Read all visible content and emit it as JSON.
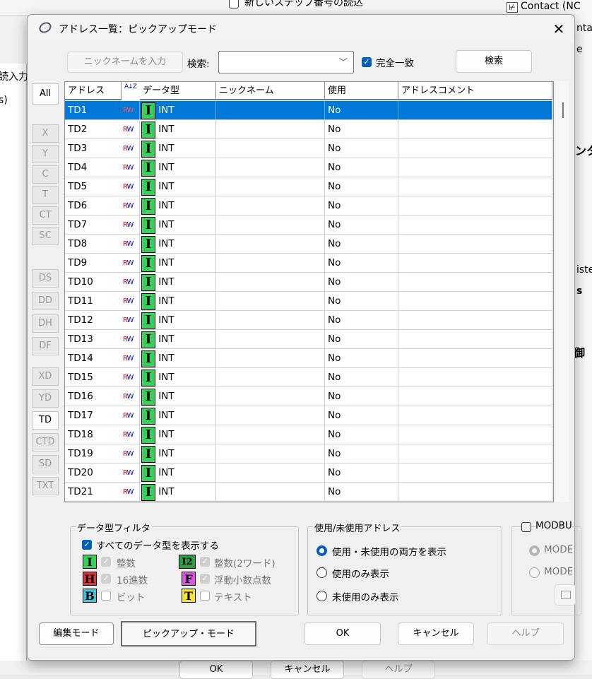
{
  "background": {
    "top_text": "新しいステップ番号の読込",
    "top_right": "Contact (NC",
    "right_fragments": [
      "nta",
      "e",
      "ンタ",
      "iste",
      "s",
      "御"
    ],
    "left_fragments": [
      "読入力",
      "s)"
    ],
    "bottom_buttons": [
      "OK",
      "キャンセル",
      "ヘルプ"
    ]
  },
  "dialog": {
    "title": "アドレス一覧：ピックアップモード",
    "close": "✕",
    "toolbar": {
      "nickname_button": "ニックネームを入力",
      "search_label": "検索:",
      "search_value": "",
      "exact_match": "完全一致",
      "search_button": "検索"
    },
    "side_tabs": [
      "All",
      "X",
      "Y",
      "C",
      "T",
      "CT",
      "SC",
      "DS",
      "DD",
      "DH",
      "DF",
      "XD",
      "YD",
      "TD",
      "CTD",
      "SD",
      "TXT"
    ],
    "active_tab": "TD",
    "columns": [
      "アドレス",
      "データ型",
      "ニックネーム",
      "使用",
      "アドレスコメント"
    ],
    "sort_icon": "A↓Z",
    "rows": [
      {
        "addr": "TD1",
        "rw": "RW",
        "type": "INT",
        "nick": "",
        "used": "No",
        "comment": ""
      },
      {
        "addr": "TD2",
        "rw": "RW",
        "type": "INT",
        "nick": "",
        "used": "No",
        "comment": ""
      },
      {
        "addr": "TD3",
        "rw": "RW",
        "type": "INT",
        "nick": "",
        "used": "No",
        "comment": ""
      },
      {
        "addr": "TD4",
        "rw": "RW",
        "type": "INT",
        "nick": "",
        "used": "No",
        "comment": ""
      },
      {
        "addr": "TD5",
        "rw": "RW",
        "type": "INT",
        "nick": "",
        "used": "No",
        "comment": ""
      },
      {
        "addr": "TD6",
        "rw": "RW",
        "type": "INT",
        "nick": "",
        "used": "No",
        "comment": ""
      },
      {
        "addr": "TD7",
        "rw": "RW",
        "type": "INT",
        "nick": "",
        "used": "No",
        "comment": ""
      },
      {
        "addr": "TD8",
        "rw": "RW",
        "type": "INT",
        "nick": "",
        "used": "No",
        "comment": ""
      },
      {
        "addr": "TD9",
        "rw": "RW",
        "type": "INT",
        "nick": "",
        "used": "No",
        "comment": ""
      },
      {
        "addr": "TD10",
        "rw": "RW",
        "type": "INT",
        "nick": "",
        "used": "No",
        "comment": ""
      },
      {
        "addr": "TD11",
        "rw": "RW",
        "type": "INT",
        "nick": "",
        "used": "No",
        "comment": ""
      },
      {
        "addr": "TD12",
        "rw": "RW",
        "type": "INT",
        "nick": "",
        "used": "No",
        "comment": ""
      },
      {
        "addr": "TD13",
        "rw": "RW",
        "type": "INT",
        "nick": "",
        "used": "No",
        "comment": ""
      },
      {
        "addr": "TD14",
        "rw": "RW",
        "type": "INT",
        "nick": "",
        "used": "No",
        "comment": ""
      },
      {
        "addr": "TD15",
        "rw": "RW",
        "type": "INT",
        "nick": "",
        "used": "No",
        "comment": ""
      },
      {
        "addr": "TD16",
        "rw": "RW",
        "type": "INT",
        "nick": "",
        "used": "No",
        "comment": ""
      },
      {
        "addr": "TD17",
        "rw": "RW",
        "type": "INT",
        "nick": "",
        "used": "No",
        "comment": ""
      },
      {
        "addr": "TD18",
        "rw": "RW",
        "type": "INT",
        "nick": "",
        "used": "No",
        "comment": ""
      },
      {
        "addr": "TD19",
        "rw": "RW",
        "type": "INT",
        "nick": "",
        "used": "No",
        "comment": ""
      },
      {
        "addr": "TD20",
        "rw": "RW",
        "type": "INT",
        "nick": "",
        "used": "No",
        "comment": ""
      },
      {
        "addr": "TD21",
        "rw": "RW",
        "type": "INT",
        "nick": "",
        "used": "No",
        "comment": ""
      }
    ],
    "selected_row": 0,
    "filter": {
      "title": "データ型フィルタ",
      "show_all": "すべてのデータ型を表示する",
      "types": [
        {
          "glyph": "I",
          "label": "整数",
          "color": "#37d05a"
        },
        {
          "glyph": "I2",
          "label": "整数(2ワード)",
          "color": "#2f9b45"
        },
        {
          "glyph": "H",
          "label": "16進数",
          "color": "#e0343a"
        },
        {
          "glyph": "F",
          "label": "浮動小数点数",
          "color": "#d35ad8"
        },
        {
          "glyph": "B",
          "label": "ビット",
          "color": "#46c4d6"
        },
        {
          "glyph": "T",
          "label": "テキスト",
          "color": "#f0e43a"
        }
      ]
    },
    "usage": {
      "title": "使用/未使用アドレス",
      "options": [
        "使用・未使用の両方を表示",
        "使用のみ表示",
        "未使用のみ表示"
      ],
      "selected": 0
    },
    "modbus": {
      "title": "MODBU",
      "options": [
        "MODE",
        "MODE"
      ]
    },
    "bottom": {
      "edit_mode": "編集モード",
      "pickup_mode": "ピックアップ・モード",
      "ok": "OK",
      "cancel": "キャンセル",
      "help": "ヘルプ"
    }
  }
}
